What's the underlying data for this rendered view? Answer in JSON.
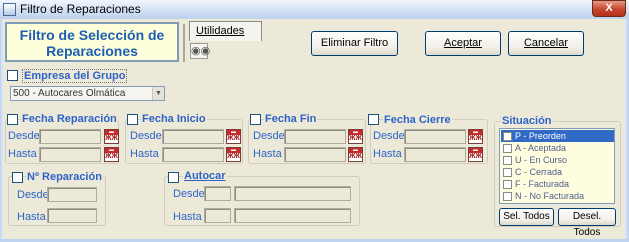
{
  "window": {
    "title": "Filtro de Reparaciones",
    "close_label": "X"
  },
  "header": {
    "line1": "Filtro de Selección de",
    "line2": "Reparaciones"
  },
  "utilities": {
    "tab_label": "Utilidades",
    "icon": "binoculars-icon"
  },
  "buttons": {
    "clear": "Eliminar Filtro",
    "accept": "Aceptar",
    "cancel": "Cancelar"
  },
  "empresa": {
    "label": "Empresa del Grupo",
    "value": "500 - Autocares Olmática"
  },
  "dates": {
    "desde": "Desde",
    "hasta": "Hasta",
    "groups": [
      {
        "label": "Fecha Reparación"
      },
      {
        "label": "Fecha Inicio"
      },
      {
        "label": "Fecha Fin"
      },
      {
        "label": "Fecha Cierre"
      }
    ]
  },
  "reparacion": {
    "label": "Nº Reparación",
    "desde": "Desde",
    "hasta": "Hasta"
  },
  "autocar": {
    "label": "Autocar",
    "desde": "Desde",
    "hasta": "Hasta"
  },
  "situacion": {
    "label": "Situación",
    "items": [
      "P - Preorden",
      "A - Aceptada",
      "U - En Curso",
      "C - Cerrada",
      "F - Facturada",
      "N - No Facturada"
    ],
    "selected_index": 0,
    "select_all": "Sel. Todos",
    "deselect_all": "Desel. Todos"
  },
  "colors": {
    "accent_blue": "#2e64c8",
    "header_bg": "#fffeda",
    "selection": "#316ac5"
  }
}
